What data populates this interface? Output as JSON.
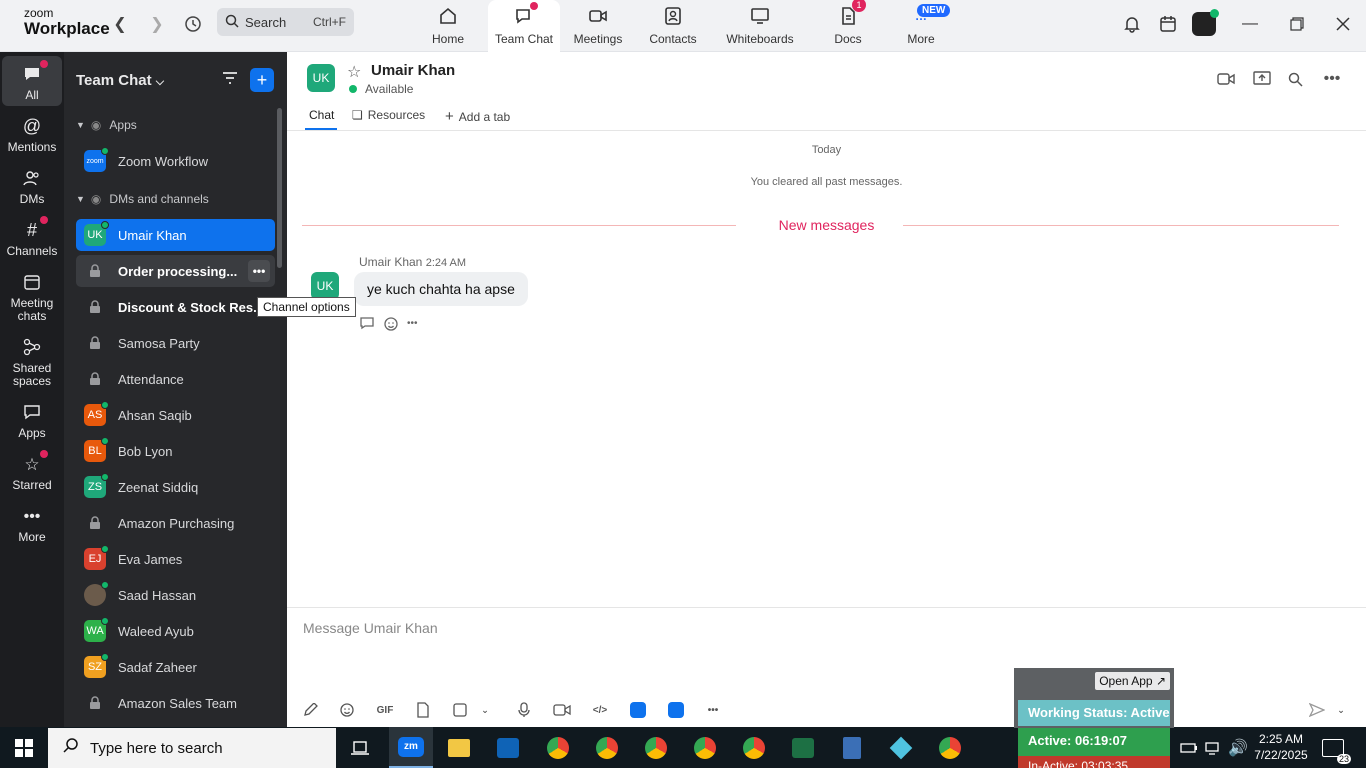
{
  "app": {
    "logo_line1": "zoom",
    "logo_line2": "Workplace"
  },
  "search": {
    "label": "Search",
    "shortcut": "Ctrl+F"
  },
  "topnav": [
    {
      "label": "Home"
    },
    {
      "label": "Team Chat"
    },
    {
      "label": "Meetings"
    },
    {
      "label": "Contacts"
    },
    {
      "label": "Whiteboards"
    },
    {
      "label": "Docs",
      "badge": "1"
    },
    {
      "label": "More",
      "badge": "NEW"
    }
  ],
  "leftbar": [
    {
      "label": "All"
    },
    {
      "label": "Mentions"
    },
    {
      "label": "DMs"
    },
    {
      "label": "Channels"
    },
    {
      "label": "Meeting chats"
    },
    {
      "label": "Shared spaces"
    },
    {
      "label": "Apps"
    },
    {
      "label": "Starred"
    },
    {
      "label": "More"
    }
  ],
  "panel": {
    "title": "Team Chat",
    "section_apps": "Apps",
    "section_dms": "DMs and channels",
    "items": [
      {
        "label": "Zoom Workflow",
        "initials": "zoom",
        "color": "#0e72ed"
      },
      {
        "label": "Umair Khan",
        "initials": "UK",
        "color": "#1fa87a"
      },
      {
        "label": "Order processing..."
      },
      {
        "label": "Discount & Stock Res..."
      },
      {
        "label": "Samosa Party"
      },
      {
        "label": "Attendance"
      },
      {
        "label": "Ahsan Saqib",
        "initials": "AS",
        "color": "#e8590c"
      },
      {
        "label": "Bob Lyon",
        "initials": "BL",
        "color": "#e8590c"
      },
      {
        "label": "Zeenat Siddiq",
        "initials": "ZS",
        "color": "#1fa87a"
      },
      {
        "label": "Amazon Purchasing"
      },
      {
        "label": "Eva James",
        "initials": "EJ",
        "color": "#d9412e"
      },
      {
        "label": "Saad Hassan",
        "initials": "",
        "color": "#6b5b4b"
      },
      {
        "label": "Waleed Ayub",
        "initials": "WA",
        "color": "#2db14a"
      },
      {
        "label": "Sadaf Zaheer",
        "initials": "SZ",
        "color": "#f0a020"
      },
      {
        "label": "Amazon Sales Team"
      }
    ],
    "tooltip": "Channel options"
  },
  "chat": {
    "name": "Umair Khan",
    "initials": "UK",
    "status": "Available",
    "tabs": [
      "Chat",
      "Resources",
      "Add a tab"
    ],
    "today": "Today",
    "cleared": "You cleared all past messages.",
    "new_messages": "New messages",
    "message": {
      "sender": "Umair Khan",
      "time": "2:24 AM",
      "text": "ye kuch chahta ha apse"
    },
    "composer_placeholder": "Message Umair Khan",
    "gif_label": "GIF"
  },
  "widget": {
    "open_app": "Open App",
    "working_status": "Working Status: Active",
    "active_time": "Active: 06:19:07",
    "inactive_time": "In-Active: 03:03:35"
  },
  "taskbar": {
    "search_placeholder": "Type here to search",
    "time": "2:25 AM",
    "date": "7/22/2025",
    "notif_count": "23"
  },
  "colors": {
    "accent": "#0e72ed",
    "sidebar": "#1c1d20",
    "panel": "#27282b",
    "new_messages": "#e0245e"
  }
}
